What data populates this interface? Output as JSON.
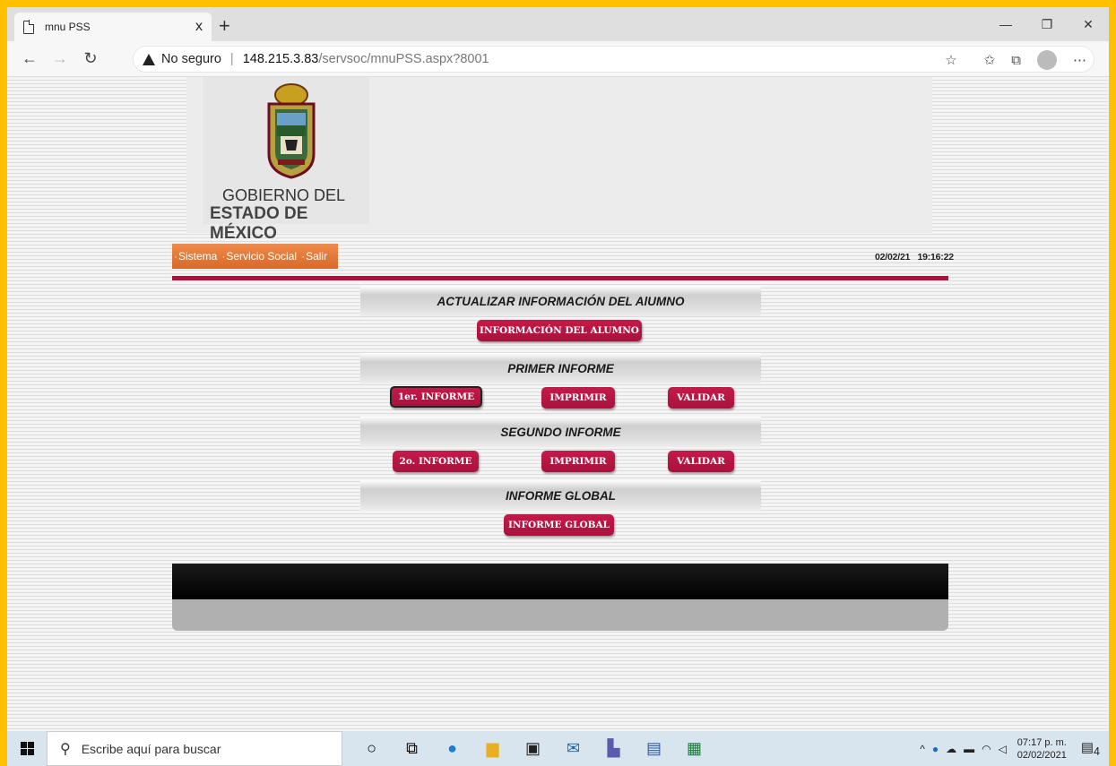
{
  "browser": {
    "tab_title": "mnu PSS",
    "tab_close": "x",
    "new_tab": "+",
    "security_label": "No seguro",
    "url_host": "148.215.3.83",
    "url_path": "/servsoc/mnuPSS.aspx?8001"
  },
  "logo": {
    "line1": "GOBIERNO DEL",
    "line2": "ESTADO DE MÉXICO"
  },
  "menu": {
    "item1": "Sistema",
    "item2": "Servicio Social",
    "item3": "Salir"
  },
  "clock": {
    "date": "02/02/21",
    "time": "19:16:22"
  },
  "sections": {
    "alumno": {
      "title": "ACTUALIZAR INFORMACIÓN DEL AlUMNO",
      "btn": "INFORMACIÓN DEL ALUMNO"
    },
    "primer": {
      "title": "PRIMER INFORME",
      "btn_informe": "1er. INFORME",
      "btn_imprimir": "IMPRIMIR",
      "btn_validar": "VALIDAR"
    },
    "segundo": {
      "title": "SEGUNDO INFORME",
      "btn_informe": "2o. INFORME",
      "btn_imprimir": "IMPRIMIR",
      "btn_validar": "VALIDAR"
    },
    "global": {
      "title": "INFORME GLOBAL",
      "btn": "INFORME GLOBAL"
    }
  },
  "taskbar": {
    "search_placeholder": "Escribe aquí para buscar",
    "time": "07:17 p. m.",
    "date": "02/02/2021",
    "notif_count": "4"
  },
  "colors": {
    "accent": "#a8123c",
    "menu_orange": "#e07a3a",
    "frame": "#ffc000"
  }
}
